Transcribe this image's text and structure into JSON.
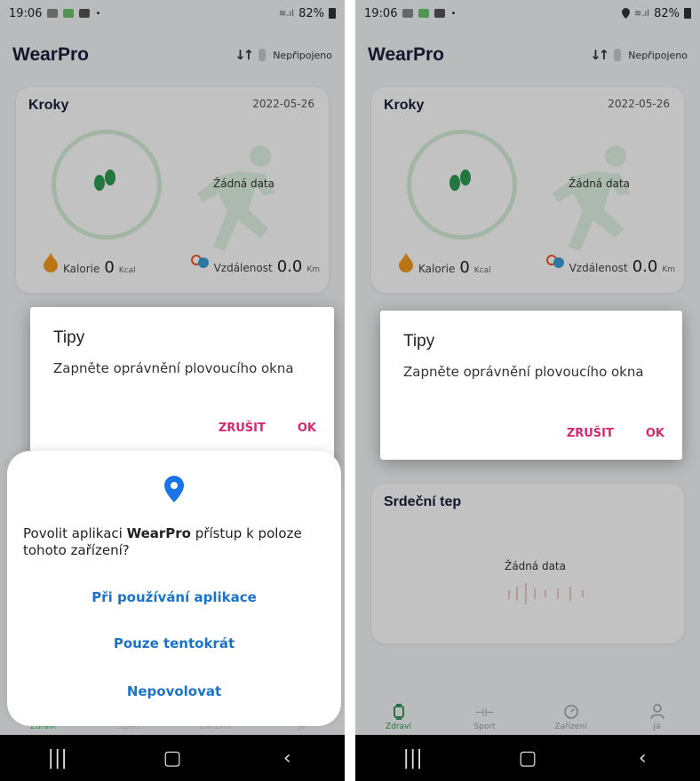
{
  "screens": {
    "left": {
      "status": {
        "time": "19:06",
        "battery": "82%"
      },
      "app_title": "WearPro",
      "connection": "Nepřipojeno",
      "steps_card": {
        "title": "Kroky",
        "date": "2022-05-26",
        "no_data": "Žádná data",
        "calories_label": "Kalorie",
        "calories_value": "0",
        "calories_unit": "Kcal",
        "distance_label": "Vzdálenost",
        "distance_value": "0.0",
        "distance_unit": "Km"
      },
      "tips_dialog": {
        "title": "Tipy",
        "message": "Zapněte oprávnění plovoucího okna",
        "cancel": "ZRUŠIT",
        "ok": "OK"
      },
      "permission_sheet": {
        "message_prefix": "Povolit aplikaci ",
        "message_app": "WearPro",
        "message_suffix": " přístup k poloze tohoto zařízení?",
        "option_while_using": "Při používání aplikace",
        "option_once": "Pouze tentokrát",
        "option_deny": "Nepovolovat"
      },
      "nav": [
        "Zdraví",
        "Sport",
        "Zařízení",
        "Já"
      ]
    },
    "right": {
      "status": {
        "time": "19:06",
        "battery": "82%"
      },
      "app_title": "WearPro",
      "connection": "Nepřipojeno",
      "steps_card": {
        "title": "Kroky",
        "date": "2022-05-26",
        "no_data": "Žádná data",
        "calories_label": "Kalorie",
        "calories_value": "0",
        "calories_unit": "Kcal",
        "distance_label": "Vzdálenost",
        "distance_value": "0.0",
        "distance_unit": "Km"
      },
      "tips_dialog": {
        "title": "Tipy",
        "message": "Zapněte oprávnění plovoucího okna",
        "cancel": "ZRUŠIT",
        "ok": "OK"
      },
      "heart_card": {
        "title": "Srdeční tep",
        "no_data": "Žádná data"
      },
      "nav": [
        "Zdraví",
        "Sport",
        "Zařízení",
        "Já"
      ]
    }
  },
  "colors": {
    "accent_pink": "#d6286f",
    "link_blue": "#1b73c9",
    "health_green": "#2e9b52",
    "pin_blue": "#1a73e8"
  }
}
